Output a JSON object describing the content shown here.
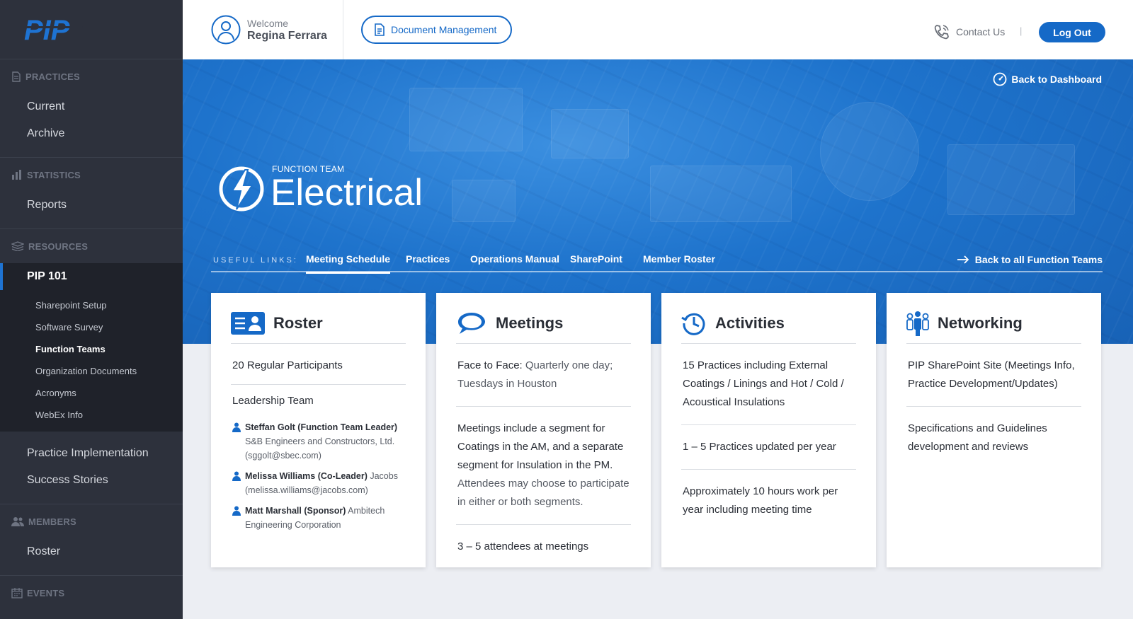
{
  "sidebar": {
    "logo": "PIP",
    "sections": [
      {
        "heading": "PRACTICES",
        "icon": "document-icon",
        "items": [
          "Current",
          "Archive"
        ]
      },
      {
        "heading": "STATISTICS",
        "icon": "bar-chart-icon",
        "items": [
          "Reports"
        ]
      },
      {
        "heading": "RESOURCES",
        "icon": "layers-icon"
      },
      {
        "heading": "MEMBERS",
        "icon": "users-icon",
        "items": [
          "Roster"
        ]
      },
      {
        "heading": "EVENTS",
        "icon": "calendar-icon"
      }
    ],
    "resources": {
      "active_item": "PIP 101",
      "sub_items": [
        "Sharepoint Setup",
        "Software Survey",
        "Function Teams",
        "Organization Documents",
        "Acronyms",
        "WebEx Info"
      ],
      "active_sub": "Function Teams",
      "more_items": [
        "Practice Implementation",
        "Success Stories"
      ]
    }
  },
  "header": {
    "welcome": "Welcome",
    "user_name": "Regina Ferrara",
    "doc_button": "Document Management",
    "contact": "Contact Us",
    "separator": "|",
    "logout": "Log Out"
  },
  "hero": {
    "back_dashboard": "Back to Dashboard",
    "team_label": "FUNCTION TEAM",
    "team_name": "Electrical",
    "useful_links_label": "USEFUL LINKS:",
    "links": [
      "Meeting Schedule",
      "Practices",
      "Operations Manual",
      "SharePoint",
      "Member Roster"
    ],
    "back_teams": "Back to all Function Teams"
  },
  "cards": {
    "roster": {
      "title": "Roster",
      "participants": "20 Regular Participants",
      "leadership_title": "Leadership Team",
      "members": [
        {
          "name": "Steffan Golt (Function Team Leader)",
          "detail": "S&B Engineers and Constructors, Ltd. (sggolt@sbec.com)"
        },
        {
          "name": "Melissa Williams (Co-Leader)",
          "detail": "Jacobs (melissa.williams@jacobs.com)"
        },
        {
          "name": "Matt Marshall (Sponsor)",
          "detail": "Ambitech Engineering Corporation"
        }
      ]
    },
    "meetings": {
      "title": "Meetings",
      "f2f_label": "Face to Face:",
      "f2f_text": "Quarterly one day; Tuesdays in Houston",
      "segment_bold": "Meetings include a segment for Coatings in the AM, and a separate segment for Insulation in the PM.",
      "segment_light": "Attendees may choose to participate in either or both segments.",
      "attendees": "3 – 5 attendees at meetings"
    },
    "activities": {
      "title": "Activities",
      "b1": "15 Practices including External Coatings / Linings and Hot / Cold / Acoustical Insulations",
      "b2": "1 – 5 Practices updated per year",
      "b3": "Approximately 10 hours work per year including meeting time"
    },
    "networking": {
      "title": "Networking",
      "b1": "PIP SharePoint Site (Meetings Info, Practice Development/Updates)",
      "b2": "Specifications and Guidelines development and reviews"
    }
  },
  "colors": {
    "accent": "#1569c7",
    "sidebar": "#2d313c",
    "hero": "#1e73cc"
  }
}
